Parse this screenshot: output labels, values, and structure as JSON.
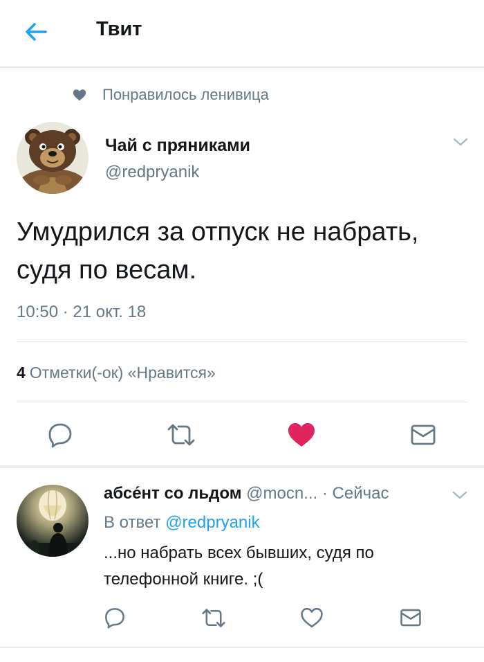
{
  "header": {
    "title": "Твит"
  },
  "social_context": {
    "text": "Понравилось ленивица"
  },
  "tweet": {
    "author_name": "Чай с пряниками",
    "author_handle": "@redpryanik",
    "text": "Умудрился за отпуск не набрать, судя по весам.",
    "timestamp": "10:50 · 21 окт. 18",
    "likes_count": "4",
    "likes_label": "Отметки(-ок) «Нравится»",
    "liked": true
  },
  "reply": {
    "author_name": "абсе́нт со льдом",
    "author_handle": "@mocn...",
    "time": "· Сейчас",
    "reply_to_label": "В ответ",
    "reply_to_mention": "@redpryanik",
    "text": "...но набрать всех бывших, судя по телефонной книге. ;("
  },
  "colors": {
    "accent": "#1da1f2",
    "like": "#e0245e",
    "icon_gray": "#657786"
  }
}
